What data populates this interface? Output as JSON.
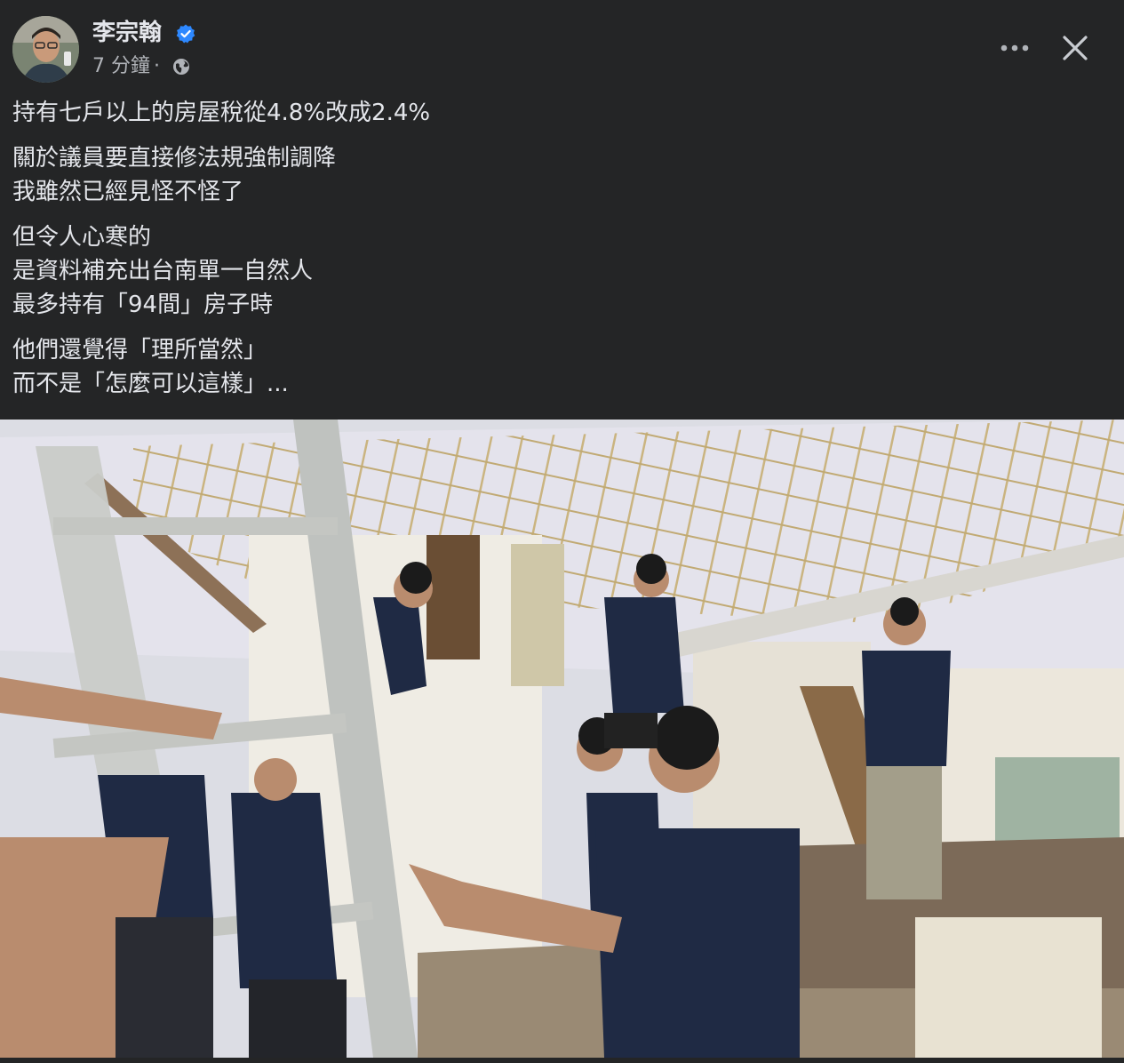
{
  "post": {
    "author": {
      "name": "李宗翰",
      "verified": true,
      "avatar_icon": "avatar-photo"
    },
    "meta": {
      "time": "7 分鐘",
      "separator": "·",
      "audience_icon": "globe-icon"
    },
    "actions": {
      "more_icon": "more-horizontal-icon",
      "close_icon": "close-icon"
    },
    "paragraphs": [
      [
        "持有七戶以上的房屋稅從4.8%改成2.4%"
      ],
      [
        "關於議員要直接修法規強制調降",
        "我雖然已經見怪不怪了"
      ],
      [
        "但令人心寒的",
        "是資料補充出台南單一自然人",
        "最多持有「94間」房子時"
      ],
      [
        "他們還覺得「理所當然」",
        "而不是「怎麼可以這樣」..."
      ]
    ],
    "photo": {
      "icon": "post-photo-renovation-scene"
    }
  },
  "colors": {
    "background": "#242526",
    "text_primary": "#e4e6eb",
    "text_secondary": "#b0b3b8",
    "verified_blue": "#2d88ff",
    "shirt_navy": "#1f2a44"
  }
}
